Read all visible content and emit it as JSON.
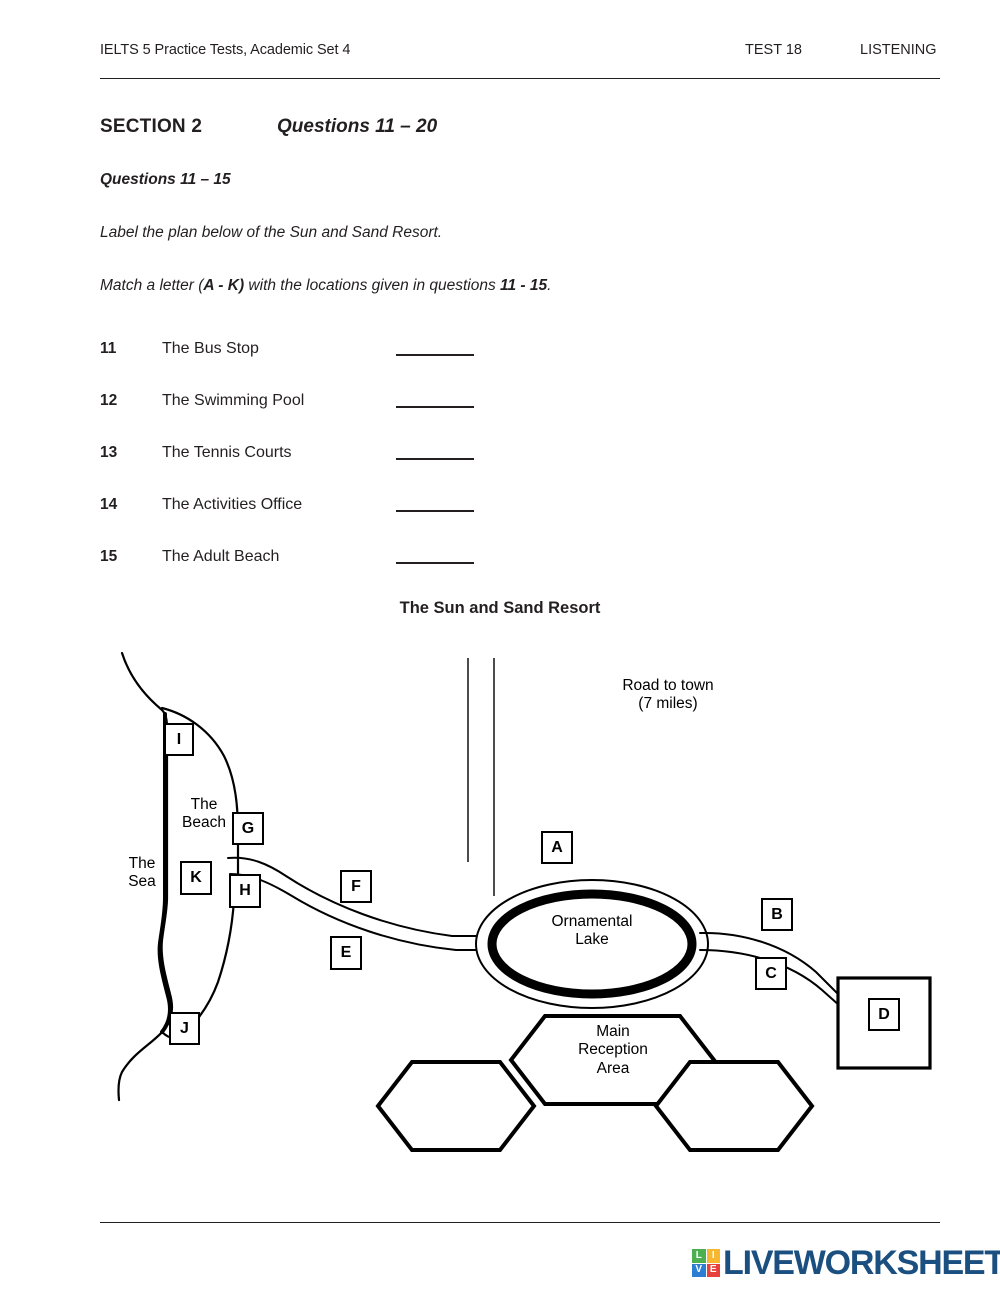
{
  "header": {
    "book_title": "IELTS 5 Practice Tests, Academic Set 4",
    "test_label": "TEST 18",
    "skill_label": "LISTENING"
  },
  "section": {
    "title": "SECTION 2",
    "question_range": "Questions 11 – 20",
    "sub_range": "Questions 11 – 15",
    "instruction_1": "Label the plan below of the Sun and Sand Resort.",
    "instruction_2_part1": "Match a letter (",
    "instruction_2_bold1": "A - K)",
    "instruction_2_part2": " with the locations given in questions ",
    "instruction_2_bold2": "11 - 15",
    "instruction_2_part3": "."
  },
  "questions": [
    {
      "number": "11",
      "text": "The Bus Stop",
      "answer": ""
    },
    {
      "number": "12",
      "text": "The Swimming Pool",
      "answer": ""
    },
    {
      "number": "13",
      "text": "The Tennis Courts",
      "answer": ""
    },
    {
      "number": "14",
      "text": "The Activities Office",
      "answer": ""
    },
    {
      "number": "15",
      "text": "The Adult Beach",
      "answer": ""
    }
  ],
  "map": {
    "title": "The Sun and Sand Resort",
    "labels": {
      "sea": "The\nSea",
      "beach": "The\nBeach",
      "road_to_town": "Road to town\n(7 miles)",
      "lake": "Ornamental\nLake",
      "reception": "Main\nReception\nArea"
    },
    "letter_boxes": [
      {
        "id": "A",
        "label": "A"
      },
      {
        "id": "B",
        "label": "B"
      },
      {
        "id": "C",
        "label": "C"
      },
      {
        "id": "D",
        "label": "D"
      },
      {
        "id": "E",
        "label": "E"
      },
      {
        "id": "F",
        "label": "F"
      },
      {
        "id": "G",
        "label": "G"
      },
      {
        "id": "H",
        "label": "H"
      },
      {
        "id": "I",
        "label": "I"
      },
      {
        "id": "J",
        "label": "J"
      },
      {
        "id": "K",
        "label": "K"
      }
    ]
  },
  "footer": {
    "brand": "LIVEWORKSHEETS",
    "logo_cells": [
      {
        "letter": "L",
        "color": "#4caf50"
      },
      {
        "letter": "I",
        "color": "#f7b731"
      },
      {
        "letter": "V",
        "color": "#2d7dd2"
      },
      {
        "letter": "E",
        "color": "#e8413c"
      }
    ],
    "brand_color": "#1a4f80"
  }
}
